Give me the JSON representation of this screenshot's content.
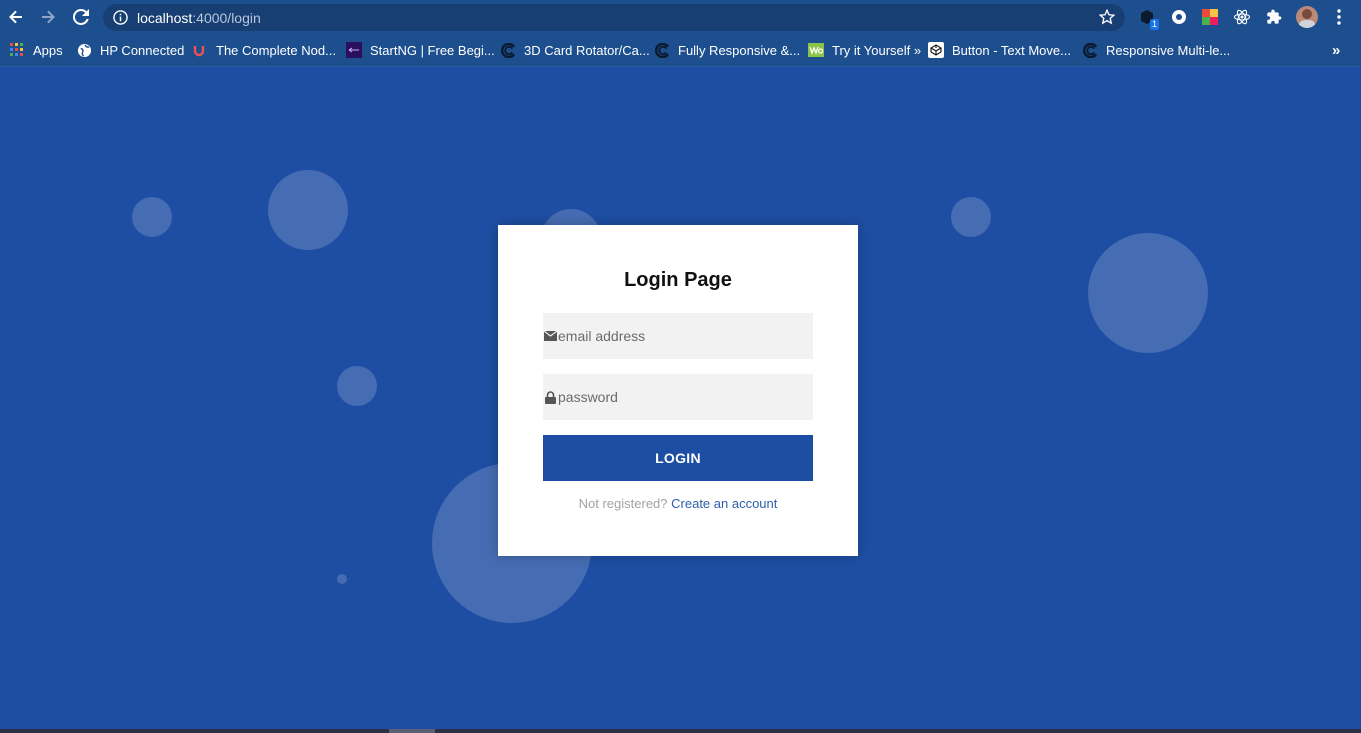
{
  "browser": {
    "url_host": "localhost",
    "url_path": ":4000/login",
    "extensions": [
      "extension-badge-icon",
      "cookie-icon",
      "color-grid-icon",
      "react-icon",
      "puzzle-icon",
      "profile-avatar",
      "kebab-menu-icon"
    ],
    "extension_badge_count": "1"
  },
  "bookmarks": [
    {
      "label": "Apps",
      "icon": "apps-grid-icon"
    },
    {
      "label": "HP Connected",
      "icon": "globe-icon"
    },
    {
      "label": "The Complete Nod...",
      "icon": "udemy-icon"
    },
    {
      "label": "StartNG | Free Begi...",
      "icon": "startng-icon"
    },
    {
      "label": "3D Card Rotator/Ca...",
      "icon": "swirl-icon"
    },
    {
      "label": "Fully Responsive &...",
      "icon": "swirl-icon"
    },
    {
      "label": "Try it Yourself »",
      "icon": "w3-icon"
    },
    {
      "label": "Button - Text Move...",
      "icon": "codepen-icon"
    },
    {
      "label": "Responsive Multi-le...",
      "icon": "swirl-icon"
    }
  ],
  "bookmarks_overflow": "»",
  "login": {
    "title": "Login Page",
    "email_placeholder": "email address",
    "password_placeholder": "password",
    "button_label": "LOGIN",
    "register_prompt": "Not registered?",
    "register_link": "Create an account"
  },
  "colors": {
    "page_background": "#1e4ea3",
    "button": "#1e4ea3",
    "link": "#2d5fa8"
  }
}
